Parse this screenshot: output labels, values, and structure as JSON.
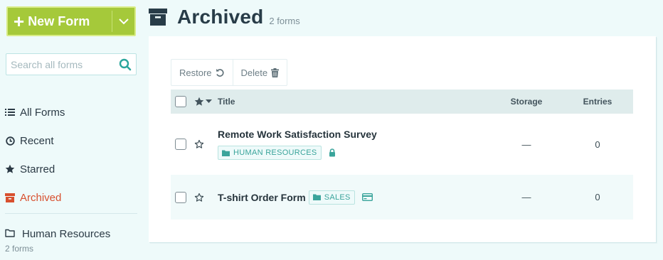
{
  "sidebar": {
    "new_form_label": "New Form",
    "search_placeholder": "Search all forms",
    "nav": [
      {
        "label": "All Forms",
        "icon": "list-icon"
      },
      {
        "label": "Recent",
        "icon": "clock-icon"
      },
      {
        "label": "Starred",
        "icon": "star-icon"
      },
      {
        "label": "Archived",
        "icon": "archive-icon",
        "active": true
      }
    ],
    "folder": {
      "label": "Human Resources",
      "count": "2 forms"
    }
  },
  "header": {
    "title": "Archived",
    "count": "2 forms"
  },
  "toolbar": {
    "restore_label": "Restore",
    "delete_label": "Delete"
  },
  "table": {
    "columns": {
      "title": "Title",
      "storage": "Storage",
      "entries": "Entries"
    },
    "rows": [
      {
        "title": "Remote Work Satisfaction Survey",
        "folder": "HUMAN RESOURCES",
        "storage": "—",
        "entries": "0",
        "extra_icon": "lock-icon"
      },
      {
        "title": "T-shirt Order Form",
        "folder": "SALES",
        "storage": "—",
        "entries": "0",
        "extra_icon": "credit-card-icon"
      }
    ]
  },
  "colors": {
    "accent": "#a5c93a",
    "active": "#d8502f",
    "tag": "#3aa49b"
  }
}
